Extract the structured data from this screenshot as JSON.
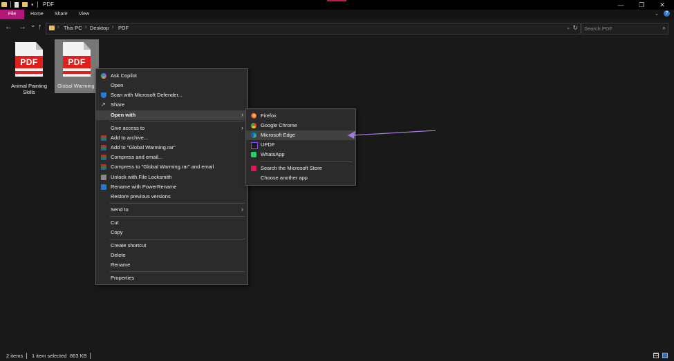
{
  "window": {
    "title": "PDF",
    "controls": {
      "minimize": "—",
      "maximize": "❐",
      "close": "✕"
    }
  },
  "ribbon": {
    "tabs": [
      "File",
      "Home",
      "Share",
      "View"
    ],
    "help": "?"
  },
  "nav": {
    "back": "←",
    "forward": "→",
    "recent": "⌄",
    "up": "↑"
  },
  "address": {
    "crumbs": [
      "This PC",
      "Desktop",
      "PDF"
    ],
    "separator": "›"
  },
  "search": {
    "placeholder": "Search PDF"
  },
  "files": [
    {
      "name": "Animal Painting Skills",
      "icon_text": "PDF",
      "selected": false
    },
    {
      "name": "Global Warming",
      "icon_text": "PDF",
      "selected": true
    }
  ],
  "context_menu": {
    "items": [
      {
        "label": "Ask Copilot",
        "icon": "copilot-icon"
      },
      {
        "label": "Open",
        "icon": ""
      },
      {
        "label": "Scan with Microsoft Defender...",
        "icon": "defender-shield-icon"
      },
      {
        "label": "Share",
        "icon": "share-icon"
      },
      {
        "label": "Open with",
        "icon": "",
        "bold": true,
        "submenu": true,
        "highlighted": true
      },
      {
        "label": "Give access to",
        "icon": "",
        "submenu": true
      },
      {
        "label": "Add to archive...",
        "icon": "winrar-icon"
      },
      {
        "label": "Add to \"Global Warming.rar\"",
        "icon": "winrar-icon"
      },
      {
        "label": "Compress and email...",
        "icon": "winrar-icon"
      },
      {
        "label": "Compress to \"Global Warming.rar\" and email",
        "icon": "winrar-icon"
      },
      {
        "label": "Unlock with File Locksmith",
        "icon": "lock-icon"
      },
      {
        "label": "Rename with PowerRename",
        "icon": "powerrename-icon"
      },
      {
        "label": "Restore previous versions",
        "icon": ""
      },
      {
        "label": "Send to",
        "icon": "",
        "submenu": true
      },
      {
        "label": "Cut",
        "icon": ""
      },
      {
        "label": "Copy",
        "icon": ""
      },
      {
        "label": "Create shortcut",
        "icon": ""
      },
      {
        "label": "Delete",
        "icon": ""
      },
      {
        "label": "Rename",
        "icon": ""
      },
      {
        "label": "Properties",
        "icon": ""
      }
    ],
    "submenu_arrow": "›"
  },
  "open_with_menu": {
    "items": [
      {
        "label": "Firefox",
        "icon": "firefox-icon"
      },
      {
        "label": "Google Chrome",
        "icon": "chrome-icon"
      },
      {
        "label": "Microsoft Edge",
        "icon": "edge-icon",
        "highlighted": true
      },
      {
        "label": "UPDF",
        "icon": "updf-icon"
      },
      {
        "label": "WhatsApp",
        "icon": "whatsapp-icon"
      },
      {
        "label": "Search the Microsoft Store",
        "icon": "store-icon"
      },
      {
        "label": "Choose another app",
        "icon": ""
      }
    ]
  },
  "annotation": {
    "color": "#a87ae0"
  },
  "status": {
    "items_count": "2 items",
    "selected": "1 item selected",
    "size": "863 KB"
  },
  "colors": {
    "file_tab": "#b4177a",
    "pdf_red": "#e0201d",
    "folder": "#e8c25a"
  }
}
